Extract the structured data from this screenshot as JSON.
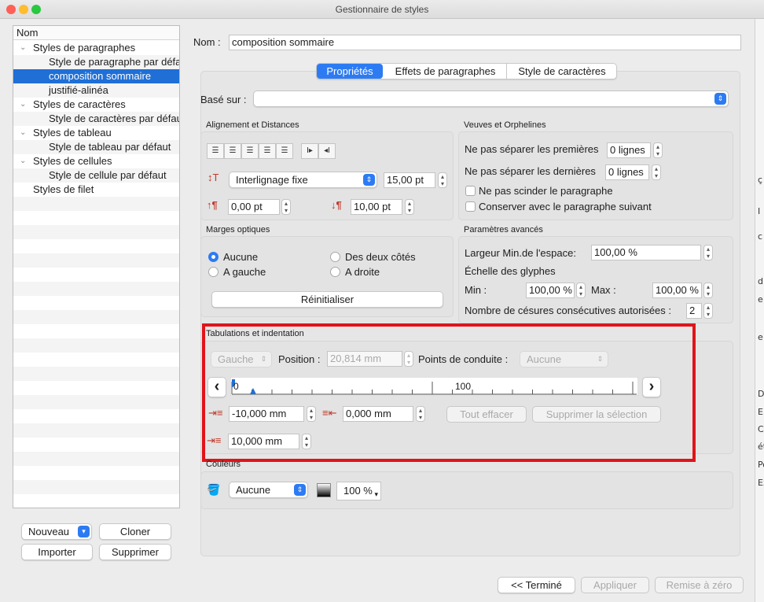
{
  "window": {
    "title": "Gestionnaire de styles"
  },
  "tree": {
    "header": "Nom",
    "items": [
      {
        "label": "Styles de paragraphes",
        "level": 0,
        "expanded": true
      },
      {
        "label": "Style de paragraphe par défaut",
        "level": 1
      },
      {
        "label": "composition sommaire",
        "level": 1,
        "selected": true
      },
      {
        "label": "justifié-alinéa",
        "level": 1
      },
      {
        "label": "Styles de caractères",
        "level": 0,
        "expanded": true
      },
      {
        "label": "Style de caractères par défaut",
        "level": 1
      },
      {
        "label": "Styles de tableau",
        "level": 0,
        "expanded": true
      },
      {
        "label": "Style de tableau par défaut",
        "level": 1
      },
      {
        "label": "Styles de cellules",
        "level": 0,
        "expanded": true
      },
      {
        "label": "Style de cellule par défaut",
        "level": 1
      },
      {
        "label": "Styles de filet",
        "level": 0
      }
    ]
  },
  "left_buttons": {
    "new": "Nouveau",
    "clone": "Cloner",
    "import": "Importer",
    "delete": "Supprimer"
  },
  "name_field": {
    "label": "Nom :",
    "value": "composition sommaire"
  },
  "tabs": [
    "Propriétés",
    "Effets de paragraphes",
    "Style de caractères"
  ],
  "based_on": {
    "label": "Basé sur :",
    "value": ""
  },
  "alignment": {
    "title": "Alignement et Distances",
    "line_spacing_mode": "Interlignage fixe",
    "line_spacing_value": "15,00 pt",
    "space_before": "0,00 pt",
    "space_after": "10,00 pt"
  },
  "widows": {
    "title": "Veuves et Orphelines",
    "first_label": "Ne pas séparer les premières",
    "first_value": "0 lignes",
    "last_label": "Ne pas séparer les dernières",
    "last_value": "0 lignes",
    "no_split_label": "Ne pas scinder le paragraphe",
    "keep_next_label": "Conserver avec le paragraphe suivant"
  },
  "optical": {
    "title": "Marges optiques",
    "none": "Aucune",
    "both": "Des deux côtés",
    "left": "A gauche",
    "right": "A droite",
    "reset": "Réinitialiser"
  },
  "advanced": {
    "title": "Paramètres avancés",
    "min_space_label": "Largeur Min.de l'espace:",
    "min_space_value": "100,00 %",
    "glyph_scale_label": "Échelle des glyphes",
    "min_label": "Min :",
    "min_value": "100,00 %",
    "max_label": "Max :",
    "max_value": "100,00 %",
    "hyphen_label": "Nombre de césures consécutives autorisées :",
    "hyphen_value": "2"
  },
  "tabs_indent": {
    "title": "Tabulations et indentation",
    "align": "Gauche",
    "position_label": "Position :",
    "position_value": "20,814 mm",
    "leader_label": "Points de conduite :",
    "leader_value": "Aucune",
    "ruler_start": "0",
    "ruler_mid": "100",
    "first_indent": "-10,000 mm",
    "right_indent": "0,000 mm",
    "left_indent": "10,000 mm",
    "clear_all": "Tout effacer",
    "delete_selection": "Supprimer la sélection"
  },
  "colors": {
    "title": "Couleurs",
    "fill": "Aucune",
    "shade": "100 %"
  },
  "bottom_buttons": {
    "done": "<< Terminé",
    "apply": "Appliquer",
    "reset": "Remise à zéro"
  },
  "highlight_color": "#e0141b",
  "accent_color": "#2d7bf3",
  "behind_window_glyphs": [
    "ç",
    "I",
    "c",
    "d",
    "e",
    "e",
    "D",
    "E",
    "Ce",
    "ét",
    "Po",
    "Ex"
  ]
}
